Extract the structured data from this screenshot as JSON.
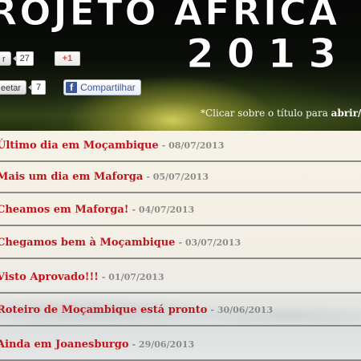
{
  "header": {
    "title_line1": "ROJETO AFRICA",
    "title_line2": "2013",
    "social": {
      "first_button_label": "r",
      "first_count": "27",
      "gplus_label": "+1",
      "second_button_label": "eetar",
      "second_count": "7",
      "share_label": "Compartilhar",
      "share_icon": "f"
    },
    "hint_prefix": "*Clicar sobre o título para ",
    "hint_bold": "abrir/f"
  },
  "posts": [
    {
      "title": "Último dia em Moçambique",
      "date": "- 08/07/2013"
    },
    {
      "title": "Mais um dia em Maforga",
      "date": "- 05/07/2013"
    },
    {
      "title": "Cheamos em Maforga!",
      "date": "- 04/07/2013"
    },
    {
      "title": "Chegamos bem à Moçambique",
      "date": "- 03/07/2013"
    },
    {
      "title": "Visto Aprovado!!!",
      "date": "- 01/07/2013"
    },
    {
      "title": "Roteiro de Moçambique está pronto",
      "date": "- 30/06/2013"
    },
    {
      "title": "Ainda em Joanesburgo",
      "date": "- 29/06/2013"
    }
  ]
}
